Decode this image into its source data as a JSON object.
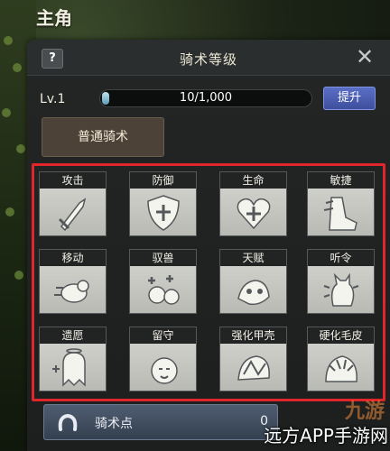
{
  "page": {
    "title": "主角"
  },
  "panel": {
    "help_label": "?",
    "title": "骑术等级",
    "close_label": "✕"
  },
  "level": {
    "label": "Lv.1",
    "progress_text": "10/1,000",
    "progress_fraction": 0.01,
    "upgrade_label": "提升"
  },
  "tab": {
    "label": "普通骑术"
  },
  "skills": [
    {
      "label": "攻击",
      "icon": "sword-icon"
    },
    {
      "label": "防御",
      "icon": "shield-icon"
    },
    {
      "label": "生命",
      "icon": "heart-icon"
    },
    {
      "label": "敏捷",
      "icon": "boot-icon"
    },
    {
      "label": "移动",
      "icon": "running-pet-icon"
    },
    {
      "label": "驭兽",
      "icon": "pets-plus-icon"
    },
    {
      "label": "天赋",
      "icon": "creature-icon"
    },
    {
      "label": "听令",
      "icon": "sitting-cat-icon"
    },
    {
      "label": "遗愿",
      "icon": "ghost-icon"
    },
    {
      "label": "留守",
      "icon": "guard-pet-icon"
    },
    {
      "label": "强化甲壳",
      "icon": "shell-creature-icon"
    },
    {
      "label": "硬化毛皮",
      "icon": "fur-creature-icon"
    }
  ],
  "bottom": {
    "label": "骑术点",
    "value": "0",
    "icon": "horseshoe-icon"
  },
  "watermark": {
    "brand": "九游",
    "text": "远方APP手游网"
  },
  "colors": {
    "highlight_frame": "#e0252b",
    "upgrade_button": "#4a5cb0",
    "progress_fill": "#8cc3da"
  }
}
